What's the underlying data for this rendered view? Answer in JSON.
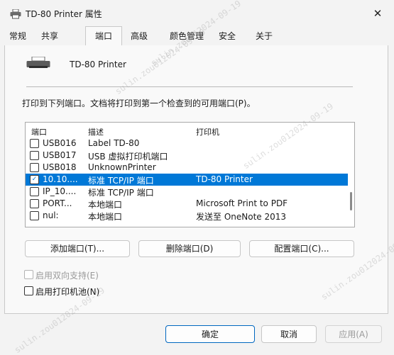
{
  "window": {
    "title": "TD-80 Printer 属性",
    "close_glyph": "✕"
  },
  "tabs": [
    {
      "label": "常规"
    },
    {
      "label": "共享"
    },
    {
      "label": "端口",
      "active": true
    },
    {
      "label": "高级"
    },
    {
      "label": "颜色管理"
    },
    {
      "label": "安全"
    },
    {
      "label": "关于"
    }
  ],
  "printer": {
    "name": "TD-80 Printer"
  },
  "description": "打印到下列端口。文档将打印到第一个检查到的可用端口(P)。",
  "port_list": {
    "columns": [
      "端口",
      "描述",
      "打印机"
    ],
    "rows": [
      {
        "port": "USB016",
        "desc": "Label TD-80",
        "printer": "",
        "checked": false,
        "selected": false
      },
      {
        "port": "USB017",
        "desc": "USB 虚拟打印机端口",
        "printer": "",
        "checked": false,
        "selected": false
      },
      {
        "port": "USB018",
        "desc": "UnknownPrinter",
        "printer": "",
        "checked": false,
        "selected": false
      },
      {
        "port": "10.10....",
        "desc": "标准 TCP/IP 端口",
        "printer": "TD-80 Printer",
        "checked": true,
        "selected": true
      },
      {
        "port": "IP_10....",
        "desc": "标准 TCP/IP 端口",
        "printer": "",
        "checked": false,
        "selected": false
      },
      {
        "port": "PORT...",
        "desc": "本地端口",
        "printer": "Microsoft Print to PDF",
        "checked": false,
        "selected": false
      },
      {
        "port": "nul:",
        "desc": "本地端口",
        "printer": "发送至 OneNote 2013",
        "checked": false,
        "selected": false
      }
    ]
  },
  "port_buttons": {
    "add": "添加端口(T)...",
    "delete": "删除端口(D)",
    "configure": "配置端口(C)..."
  },
  "options": {
    "bidirectional": {
      "label": "启用双向支持(E)",
      "checked": false,
      "disabled": true
    },
    "pooling": {
      "label": "启用打印机池(N)",
      "checked": false,
      "disabled": false
    }
  },
  "footer": {
    "ok": "确定",
    "cancel": "取消",
    "apply": "应用(A)"
  },
  "watermark": "sulin.zou012024-09-19",
  "colors": {
    "selection": "#0078d7",
    "window_bg": "#f3f3f3",
    "panel_bg": "#f9f9f9"
  }
}
